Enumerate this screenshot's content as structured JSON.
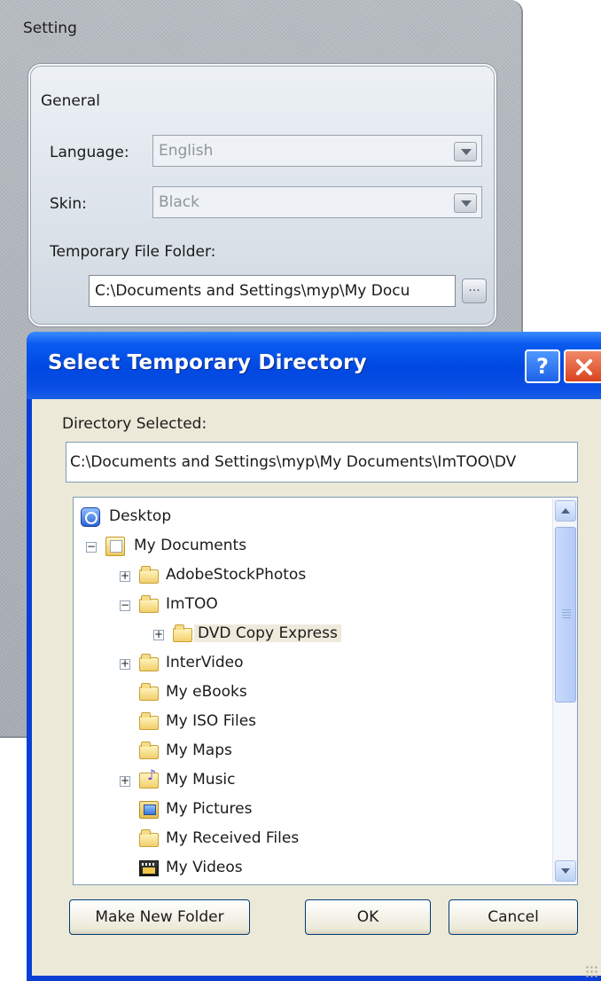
{
  "setting": {
    "title": "Setting",
    "general": {
      "title": "General",
      "language_label": "Language:",
      "language_value": "English",
      "skin_label": "Skin:",
      "skin_value": "Black",
      "temp_folder_label": "Temporary File Folder:",
      "temp_folder_value": "C:\\Documents and Settings\\myp\\My Docu",
      "browse_label": "..."
    }
  },
  "dialog": {
    "title": "Select Temporary Directory",
    "help_label": "?",
    "directory_label": "Directory Selected:",
    "directory_value": "C:\\Documents and Settings\\myp\\My Documents\\ImTOO\\DV",
    "tree": [
      {
        "label": "Desktop",
        "icon": "desktop-icon",
        "expander": ""
      },
      {
        "label": "My Documents",
        "icon": "my-documents-icon",
        "expander": "−"
      },
      {
        "label": "AdobeStockPhotos",
        "icon": "folder-icon",
        "expander": "+"
      },
      {
        "label": "ImTOO",
        "icon": "folder-icon",
        "expander": "−"
      },
      {
        "label": "DVD Copy Express",
        "icon": "folder-open-icon",
        "expander": "+",
        "selected": true
      },
      {
        "label": "InterVideo",
        "icon": "folder-icon",
        "expander": "+"
      },
      {
        "label": "My eBooks",
        "icon": "folder-icon",
        "expander": ""
      },
      {
        "label": "My ISO Files",
        "icon": "folder-icon",
        "expander": ""
      },
      {
        "label": "My Maps",
        "icon": "folder-icon",
        "expander": ""
      },
      {
        "label": "My Music",
        "icon": "music-folder-icon",
        "expander": "+"
      },
      {
        "label": "My Pictures",
        "icon": "pictures-folder-icon",
        "expander": ""
      },
      {
        "label": "My Received Files",
        "icon": "folder-icon",
        "expander": ""
      },
      {
        "label": "My Videos",
        "icon": "videos-folder-icon",
        "expander": ""
      }
    ],
    "buttons": {
      "make_new_folder": "Make New Folder",
      "ok": "OK",
      "cancel": "Cancel"
    }
  }
}
